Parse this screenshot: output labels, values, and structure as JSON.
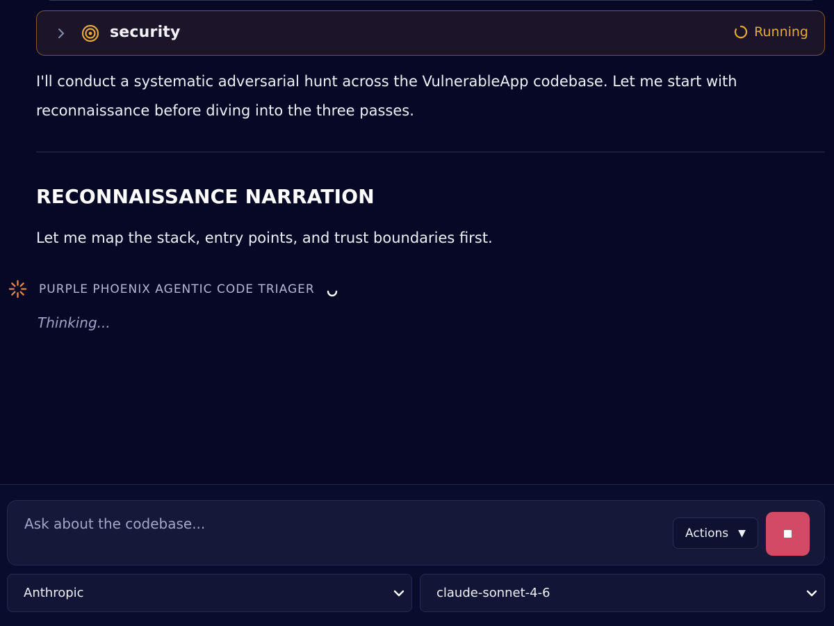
{
  "tool_card": {
    "name": "security",
    "status": "Running",
    "status_color": "#e7a93a",
    "icon": "target-icon"
  },
  "message": {
    "intro": "I'll conduct a systematic adversarial hunt across the VulnerableApp codebase. Let me start with reconnaissance before diving into the three passes.",
    "heading": "RECONNAISSANCE NARRATION",
    "paragraph": "Let me map the stack, entry points, and trust boundaries first."
  },
  "agent": {
    "name": "PURPLE PHOENIX AGENTIC CODE TRIAGER",
    "status_text": "Thinking...",
    "icon": "burst-icon"
  },
  "composer": {
    "placeholder": "Ask about the codebase...",
    "actions_label": "Actions",
    "actions_caret": "▼",
    "stop_color": "#d24a66"
  },
  "selectors": {
    "provider": "Anthropic",
    "model": "claude-sonnet-4-6"
  }
}
